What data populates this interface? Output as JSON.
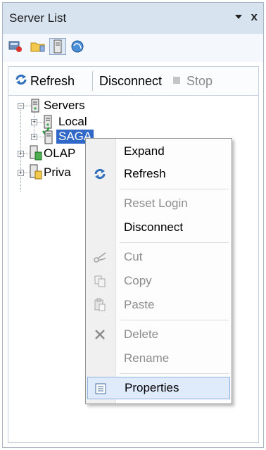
{
  "panel": {
    "title": "Server List"
  },
  "toolbar": {
    "refresh_label": "Refresh",
    "disconnect_label": "Disconnect",
    "stop_label": "Stop"
  },
  "tree": {
    "root": "Servers",
    "local": "Local",
    "saga": "SAGA",
    "olap": "OLAP",
    "private": "Priva"
  },
  "context_menu": {
    "expand": "Expand",
    "refresh": "Refresh",
    "reset_login": "Reset Login",
    "disconnect": "Disconnect",
    "cut": "Cut",
    "copy": "Copy",
    "paste": "Paste",
    "delete": "Delete",
    "rename": "Rename",
    "properties": "Properties"
  }
}
